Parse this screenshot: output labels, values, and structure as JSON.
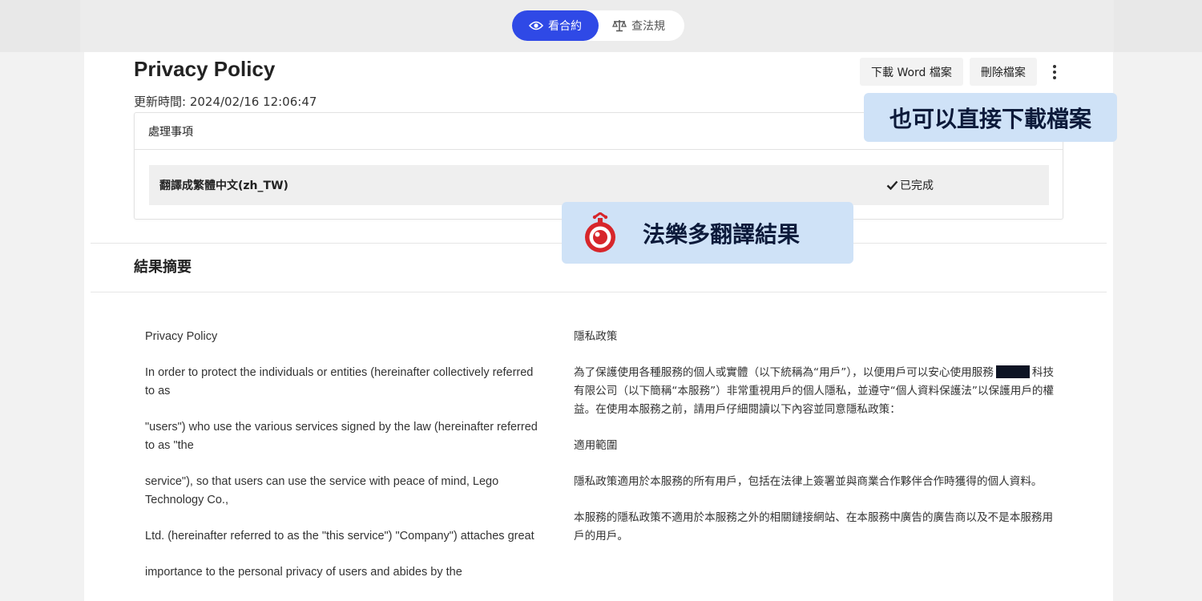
{
  "tabs": {
    "view_contract": "看合約",
    "search_law": "查法規"
  },
  "document": {
    "title": "Privacy Policy",
    "updated": "更新時間: 2024/02/16 12:06:47"
  },
  "actions": {
    "download_word": "下載 Word 檔案",
    "delete_file": "刪除檔案"
  },
  "tasks": {
    "header": "處理事項",
    "items": [
      {
        "name": "翻譯成繁體中文(zh_TW)",
        "status": "已完成"
      }
    ]
  },
  "summary": {
    "title": "結果摘要",
    "original": [
      "Privacy Policy",
      "In order to protect the individuals or entities (hereinafter collectively referred to as",
      "\"users\") who use the various services signed by the law (hereinafter referred to as \"the",
      "service\"), so that users can use the service with peace of mind, Lego Technology Co.,",
      "Ltd. (hereinafter referred to as the \"this service\") \"Company\") attaches great",
      "importance to the personal privacy of users and abides by the"
    ],
    "translated": {
      "p1": "隱私政策",
      "p2_a": "為了保護使用各種服務的個人或實體（以下統稱為“用戶”），以便用戶可以安心使用服務",
      "p2_b": "科技有限公司（以下簡稱“本服務”）非常重視用戶的個人隱私，並遵守“個人資料保護法”以保護用戶的權益。在使用本服務之前，請用戶仔細閱讀以下內容並同意隱私政策：",
      "p3": "適用範圍",
      "p4": "隱私政策適用於本服務的所有用戶，包括在法律上簽署並與商業合作夥伴合作時獲得的個人資料。",
      "p5": "本服務的隱私政策不適用於本服務之外的相關鏈接網站、在本服務中廣告的廣告商以及不是本服務用戶的用戶。"
    }
  },
  "callouts": {
    "download_hint": "也可以直接下載檔案",
    "result_label": "法樂多翻譯結果"
  },
  "colors": {
    "accent": "#2f49e6",
    "callout_bg": "#cfe2f7",
    "logo_red": "#d7262b"
  },
  "icons": [
    "eye-icon",
    "scale-icon",
    "more-vertical-icon",
    "check-icon",
    "fa-le-duo-logo"
  ]
}
